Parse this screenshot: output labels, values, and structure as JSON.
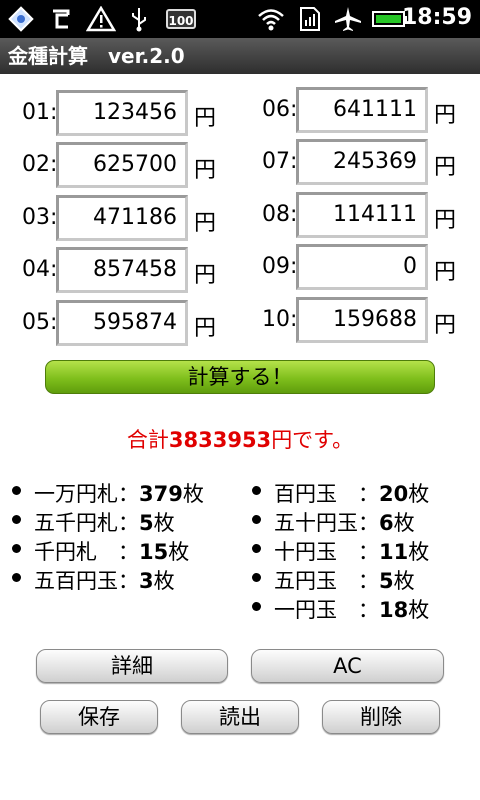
{
  "status_bar": {
    "time": "18:59",
    "battery": "100",
    "icons": [
      "app-icon",
      "refresh-icon",
      "warning-icon",
      "usb-icon",
      "battery-badge-icon",
      "wifi-icon",
      "sim-icon",
      "airplane-icon",
      "battery-icon"
    ]
  },
  "app": {
    "title": "金種計算　ver.2.0"
  },
  "inputs": [
    {
      "label": "01:",
      "value": "123456",
      "unit": "円"
    },
    {
      "label": "02:",
      "value": "625700",
      "unit": "円"
    },
    {
      "label": "03:",
      "value": "471186",
      "unit": "円"
    },
    {
      "label": "04:",
      "value": "857458",
      "unit": "円"
    },
    {
      "label": "05:",
      "value": "595874",
      "unit": "円"
    },
    {
      "label": "06:",
      "value": "641111",
      "unit": "円"
    },
    {
      "label": "07:",
      "value": "245369",
      "unit": "円"
    },
    {
      "label": "08:",
      "value": "114111",
      "unit": "円"
    },
    {
      "label": "09:",
      "value": "0",
      "unit": "円"
    },
    {
      "label": "10:",
      "value": "159688",
      "unit": "円"
    }
  ],
  "calc_button": "計算する！",
  "total": {
    "prefix": "合計",
    "amount": "3833953",
    "suffix": "円です。"
  },
  "denominations": [
    {
      "name": "一万円札",
      "sep": "：",
      "count": "379",
      "unit": "枚"
    },
    {
      "name": "五千円札",
      "sep": "：",
      "count": "5",
      "unit": "枚"
    },
    {
      "name": "千円札　",
      "sep": "：",
      "count": "15",
      "unit": "枚"
    },
    {
      "name": "五百円玉",
      "sep": "：",
      "count": "3",
      "unit": "枚"
    },
    {
      "name": "百円玉　",
      "sep": "：",
      "count": "20",
      "unit": "枚"
    },
    {
      "name": "五十円玉",
      "sep": "：",
      "count": "6",
      "unit": "枚"
    },
    {
      "name": "十円玉　",
      "sep": "：",
      "count": "11",
      "unit": "枚"
    },
    {
      "name": "五円玉　",
      "sep": "：",
      "count": "5",
      "unit": "枚"
    },
    {
      "name": "一円玉　",
      "sep": "：",
      "count": "18",
      "unit": "枚"
    }
  ],
  "buttons": {
    "detail": "詳細",
    "ac": "AC",
    "save": "保存",
    "load": "読出",
    "delete": "削除"
  },
  "colors": {
    "total_text": "#e00000",
    "calc_button": "#7fbf1c"
  }
}
